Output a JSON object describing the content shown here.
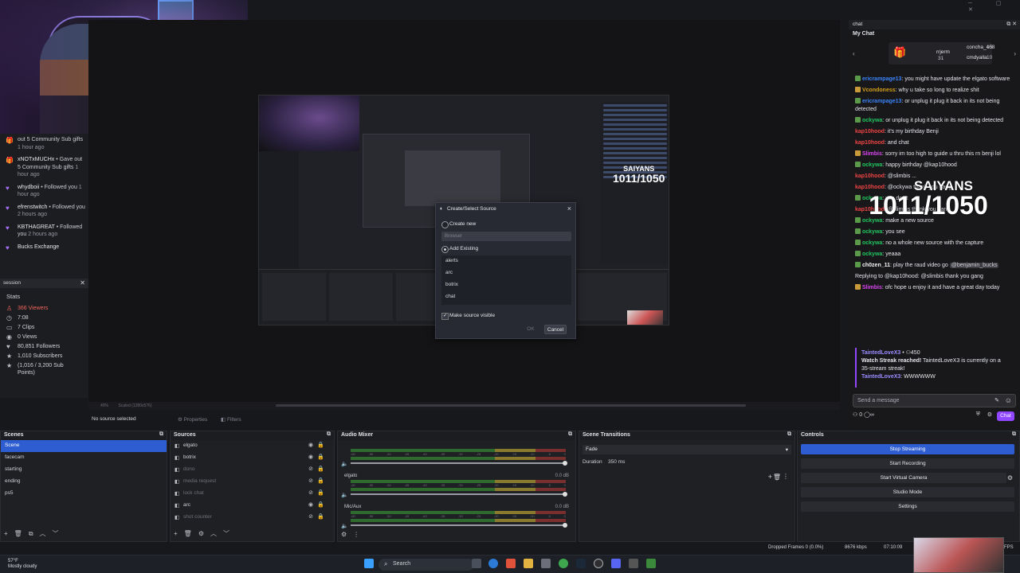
{
  "window_controls": "─ ▢ ✕",
  "feed": [
    {
      "who": "",
      "text": "out 5 Community Sub gifts",
      "time": "1 hour ago",
      "icon": "gift-icon"
    },
    {
      "who": "xNOTxMUCHx",
      "text": "• Gave out 5 Community Sub gifts",
      "time": "1 hour ago",
      "icon": "gift-icon"
    },
    {
      "who": "whydboii",
      "text": "• Followed you",
      "time": "1 hour ago",
      "icon": "heart-icon"
    },
    {
      "who": "efrenstwitch",
      "text": "• Followed you",
      "time": "2 hours ago",
      "icon": "heart-icon"
    },
    {
      "who": "KBTHAGREAT",
      "text": "• Followed you",
      "time": "2 hours ago",
      "icon": "heart-icon"
    },
    {
      "who": "Bucks Exchange",
      "text": "",
      "time": "",
      "icon": "heart-icon"
    }
  ],
  "session": {
    "title": "session",
    "stats_label": "Stats",
    "stats": [
      {
        "text": "366 Viewers",
        "icon": "person-icon",
        "highlight": true
      },
      {
        "text": "7:08",
        "icon": "clock-icon"
      },
      {
        "text": "7 Clips",
        "icon": "clip-icon"
      },
      {
        "text": "0 Views",
        "icon": "eye-icon"
      },
      {
        "text": "80,851 Followers",
        "icon": "heart-icon"
      },
      {
        "text": "1,010 Subscribers",
        "icon": "star-icon"
      },
      {
        "text": "(1,016 / 3,200 Sub Points)",
        "icon": "star-icon"
      }
    ]
  },
  "preview": {
    "zoom": "40%",
    "scaled": "Scaled (1280x576)",
    "no_source": "No source selected",
    "properties": "Properties",
    "filters": "Filters",
    "nested_saiyans": "SAIYANS",
    "nested_count": "1011/1050"
  },
  "dialog": {
    "title": "Create/Select Source",
    "create_new": "Create new",
    "input_placeholder": "Browser",
    "add_existing": "Add Existing",
    "items": [
      "alerts",
      "arc",
      "botrix",
      "chat"
    ],
    "make_visible": "Make source visible",
    "ok": "OK",
    "cancel": "Cancel"
  },
  "chat": {
    "panel_title": "chat",
    "my_chat": "My Chat",
    "gifters": [
      {
        "name": "rrjerm",
        "num": "31"
      },
      {
        "name": "concha_408",
        "num": "15"
      },
      {
        "name": "cmdyalla",
        "num": "10"
      }
    ],
    "messages": [
      {
        "user": "ericrampage13",
        "color": "#3b82f6",
        "text": "you might have update the elgato software",
        "badge": "sub"
      },
      {
        "user": "Vcondoness",
        "color": "#d4a017",
        "text": "why u take so long to realize shit",
        "badge": "mod"
      },
      {
        "user": "ericrampage13",
        "color": "#3b82f6",
        "text": "or unplug it plug it back in its not being detected",
        "badge": "sub"
      },
      {
        "user": "ockywa",
        "color": "#22c55e",
        "text": "or unplug it plug it back in its not being detected",
        "badge": "sub"
      },
      {
        "user": "kap10hood",
        "color": "#ef4444",
        "text": "it's my birthday Benji",
        "badge": ""
      },
      {
        "user": "kap10hood",
        "color": "#ef4444",
        "text": "and chat",
        "badge": ""
      },
      {
        "user": "Slimbis",
        "color": "#d946ef",
        "text": "sorry im too high to guide u thru this rn benji lol",
        "badge": "mod"
      },
      {
        "user": "ockywa",
        "color": "#22c55e",
        "text": "happy birthday @kap10hood",
        "badge": "sub"
      },
      {
        "user": "kap10hood",
        "color": "#ef4444",
        "text": "@slimbis ...",
        "badge": ""
      },
      {
        "user": "kap10hood",
        "color": "#ef4444",
        "text": "@ockywa thank you gang",
        "badge": ""
      },
      {
        "user": "ockywa",
        "color": "#22c55e",
        "text": "you don't",
        "badge": "sub"
      },
      {
        "user": "kap10hood",
        "color": "#ef4444",
        "text": "@slimbis thank you gang",
        "badge": ""
      },
      {
        "user": "ockywa",
        "color": "#22c55e",
        "text": "make a new source",
        "badge": "sub"
      },
      {
        "user": "ockywa",
        "color": "#22c55e",
        "text": "you see",
        "badge": "sub"
      },
      {
        "user": "ockywa",
        "color": "#22c55e",
        "text": "no a whole new source with the capture",
        "badge": "sub"
      },
      {
        "user": "ockywa",
        "color": "#22c55e",
        "text": "yeaaa",
        "badge": "sub"
      },
      {
        "user": "ch0zen_11",
        "color": "#f5f5f5",
        "text": "play the raud video go",
        "mention": "@benjamin_bucks",
        "badge": "sub"
      },
      {
        "user": "",
        "color": "#cfd1d7",
        "text": "Replying to @kap10hood: @slimbis thank you gang",
        "badge": ""
      },
      {
        "user": "Slimbis",
        "color": "#d946ef",
        "text": "ofc hope u enjoy it and have a great day today",
        "badge": "mod"
      }
    ],
    "saiyans": "SAIYANS",
    "goal": "1011/1050",
    "raid_user": "TaintedLoveX3",
    "raid_points": "• ⚇450",
    "raid_text": "Watch Streak reached!",
    "raid_text2": "TaintedLoveX3 is currently on a 35-stream streak!",
    "raid_reply_user": "TaintedLoveX3",
    "raid_reply": "WWWWWW",
    "send_placeholder": "Send a message",
    "points": "0",
    "chat_button": "Chat"
  },
  "scenes": {
    "title": "Scenes",
    "items": [
      "Scene",
      "facecam",
      "starting",
      "ending",
      "ps5"
    ]
  },
  "sources": {
    "title": "Sources",
    "items": [
      {
        "name": "elgato",
        "dim": false
      },
      {
        "name": "botrix",
        "dim": false
      },
      {
        "name": "dono",
        "dim": true
      },
      {
        "name": "media request",
        "dim": true
      },
      {
        "name": "lock chat",
        "dim": true
      },
      {
        "name": "arc",
        "dim": false
      },
      {
        "name": "shot counter",
        "dim": true
      }
    ]
  },
  "mixer": {
    "title": "Audio Mixer",
    "channels": [
      {
        "name": "",
        "db": ""
      },
      {
        "name": "elgato",
        "db": "0.0 dB"
      },
      {
        "name": "Mic/Aux",
        "db": "0.0 dB"
      }
    ],
    "scale": [
      "-60",
      "-55",
      "-50",
      "-45",
      "-40",
      "-35",
      "-30",
      "-25",
      "-20",
      "-15",
      "-10",
      "-5",
      "0"
    ]
  },
  "transitions": {
    "title": "Scene Transitions",
    "type": "Fade",
    "duration_label": "Duration",
    "duration": "350 ms"
  },
  "controls": {
    "title": "Controls",
    "buttons": [
      "Stop Streaming",
      "Start Recording",
      "Start Virtual Camera",
      "Studio Mode",
      "Settings"
    ]
  },
  "obs_status": {
    "dropped": "Dropped Frames 0 (0.0%)",
    "bitrate": "8676 kbps",
    "time": "07:10:09",
    "fps": "FPS"
  },
  "taskbar": {
    "temp": "57°F",
    "weather": "Mostly cloudy",
    "search": "Search"
  },
  "colors": {
    "accent": "#2d5dd1",
    "twitch": "#9147ff",
    "viewers": "#f0655a"
  }
}
